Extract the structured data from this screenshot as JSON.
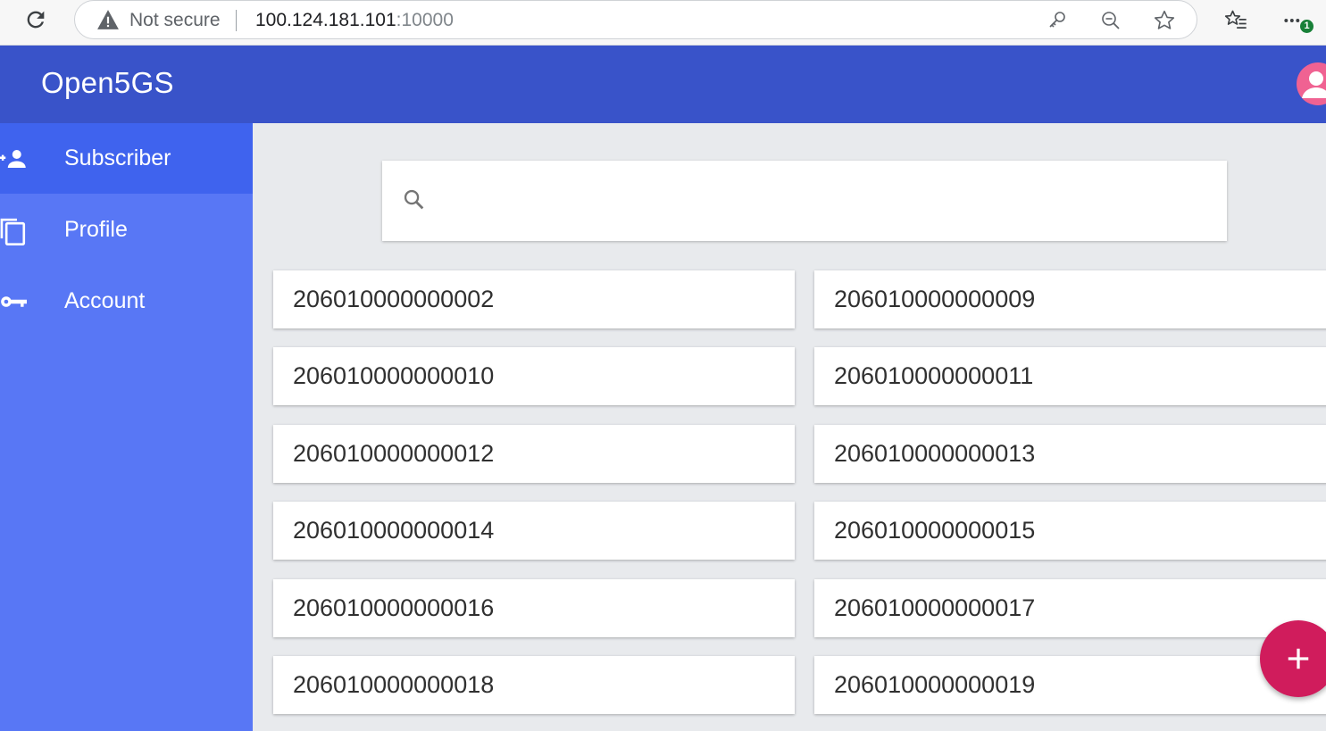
{
  "browser": {
    "security_label": "Not secure",
    "url_host": "100.124.181.101",
    "url_port": ":10000",
    "update_badge": "1"
  },
  "app": {
    "title": "Open5GS"
  },
  "sidebar": {
    "items": [
      {
        "label": "Subscriber",
        "icon": "person-add-icon",
        "active": true
      },
      {
        "label": "Profile",
        "icon": "copy-icon",
        "active": false
      },
      {
        "label": "Account",
        "icon": "key-icon",
        "active": false
      }
    ]
  },
  "search": {
    "placeholder": "",
    "value": ""
  },
  "subscribers": [
    "206010000000002",
    "206010000000009",
    "206010000000010",
    "206010000000011",
    "206010000000012",
    "206010000000013",
    "206010000000014",
    "206010000000015",
    "206010000000016",
    "206010000000017",
    "206010000000018",
    "206010000000019"
  ],
  "colors": {
    "appbar": "#3953c9",
    "sidebar": "#5877f5",
    "sidebar_active": "#3f63ee",
    "fab": "#d01c5c",
    "avatar": "#f06292"
  }
}
